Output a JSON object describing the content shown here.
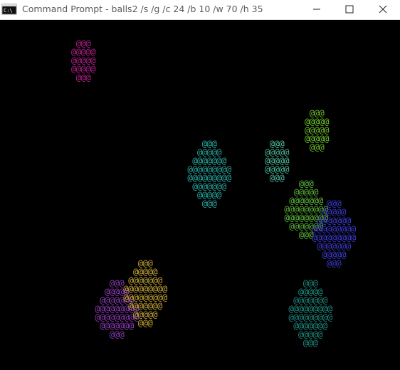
{
  "window": {
    "title": "Command Prompt - balls2  /s /g /c 24 /b 10 /w 70 /h 35",
    "icon": "command-prompt-icon",
    "controls": [
      "minimize-icon",
      "maximize-icon",
      "close-icon"
    ]
  },
  "console": {
    "background": "#000000",
    "glyph": "@",
    "balls": [
      {
        "name": "magenta-ball",
        "color": "#b0208a",
        "rows": [
          "@@@",
          "@@@@@",
          "@@@@@",
          "@@@@@",
          "@@@"
        ]
      },
      {
        "name": "green-ball-top-right",
        "color": "#6fc02a",
        "rows": [
          "@@@",
          "@@@@@",
          "@@@@@",
          "@@@@@",
          "@@@"
        ]
      },
      {
        "name": "teal-ball-center",
        "color": "#2aa8a0",
        "rows": [
          "@@@",
          "@@@@@",
          "@@@@@@@",
          "@@@@@@@@@",
          "@@@@@@@@@",
          "@@@@@@@",
          "@@@@@",
          "@@@"
        ]
      },
      {
        "name": "small-teal-ball",
        "color": "#4bb89a",
        "rows": [
          "@@@",
          "@@@@@",
          "@@@@@",
          "@@@@@",
          "@@@"
        ]
      },
      {
        "name": "green-ball-right",
        "color": "#5cb53a",
        "rows": [
          "@@@",
          "@@@@@",
          "@@@@@@@",
          "@@@@@@@@@",
          "@@@@@@@@@",
          "@@@@@@@",
          "@@@"
        ]
      },
      {
        "name": "blue-ball-right",
        "color": "#3a3ad0",
        "rows": [
          "@@@",
          "@@@@@",
          "@@@@@@@",
          "@@@@@@@@@",
          "@@@@@@@@@",
          "@@@@@@@",
          "@@@@@",
          "@@@"
        ]
      },
      {
        "name": "purple-ball",
        "color": "#8a3ab5",
        "rows": [
          "@@@",
          "@@@@@",
          "@@@@@@@",
          "@@@@@@@@@",
          "@@@@@@@@@",
          "@@@@@@@",
          "@@@"
        ]
      },
      {
        "name": "gold-ball",
        "color": "#c8a63a",
        "rows": [
          "@@@",
          "@@@@@",
          "@@@@@@@",
          "@@@@@@@@@",
          "@@@@@@@@@",
          "@@@@@@@",
          "@@@@@",
          "@@@"
        ]
      },
      {
        "name": "teal-ball-bottom",
        "color": "#208a80",
        "rows": [
          "@@@",
          "@@@@@",
          "@@@@@@@",
          "@@@@@@@@@",
          "@@@@@@@@@",
          "@@@@@@@",
          "@@@@@",
          "@@@"
        ]
      }
    ]
  }
}
